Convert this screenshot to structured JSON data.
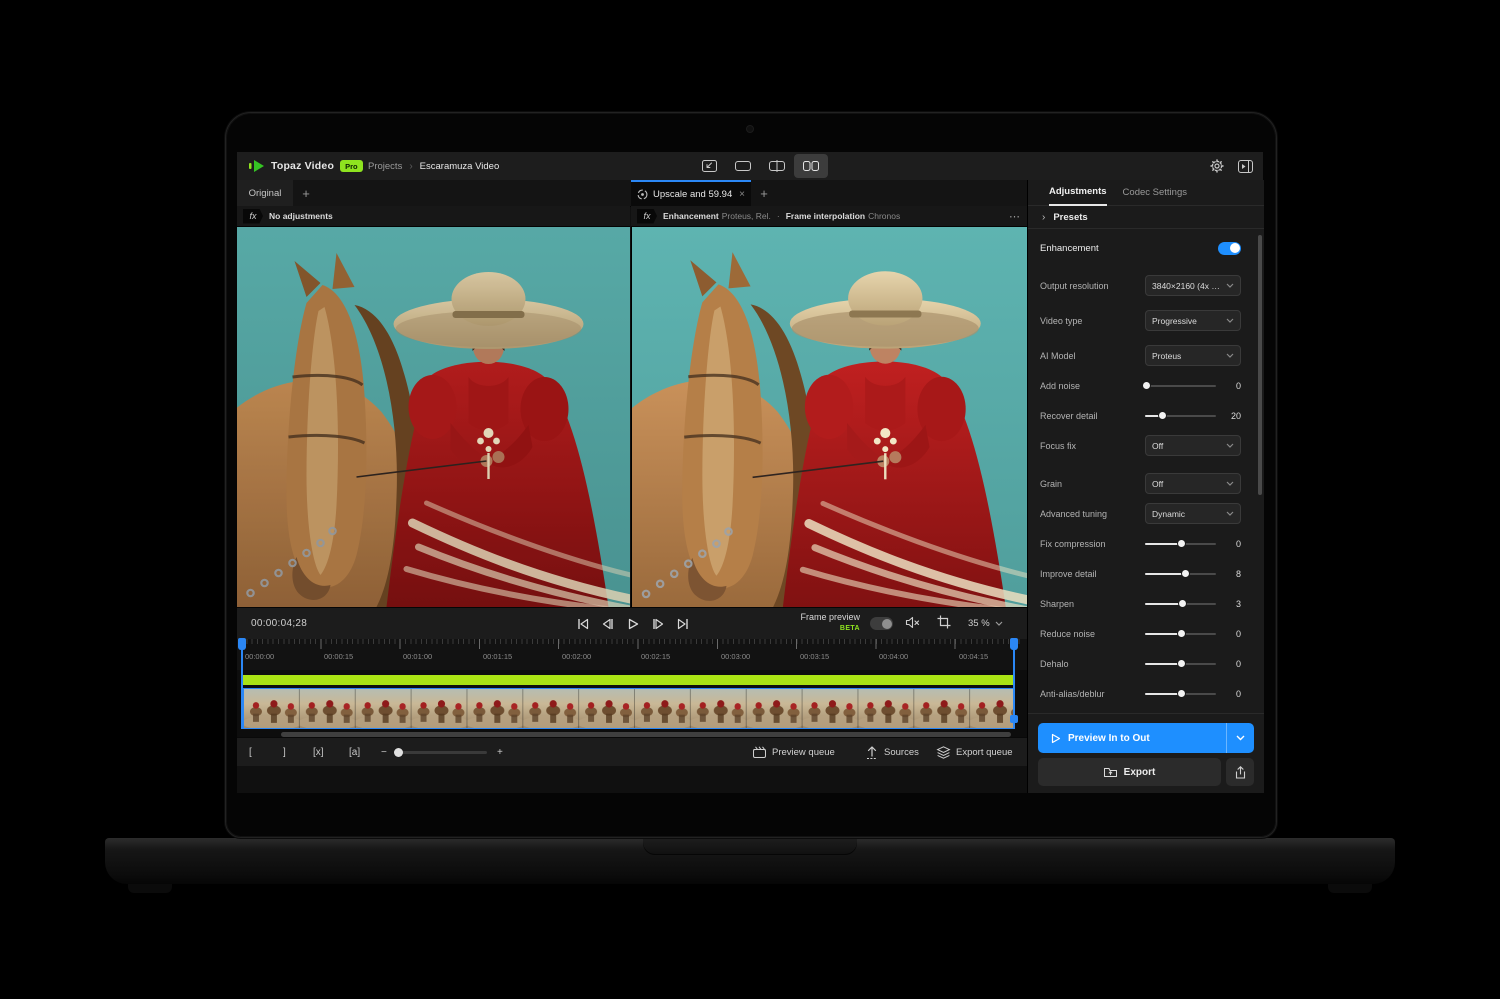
{
  "colors": {
    "accent_blue": "#1e8fff",
    "brand_green": "#8ee31f",
    "timeline_green": "#a9e214",
    "tab_accent": "#2b87f5"
  },
  "topbar": {
    "brand": "Topaz Video",
    "badge": "Pro",
    "breadcrumb": {
      "root": "Projects",
      "sep": "›",
      "current": "Escaramuza Video"
    }
  },
  "tabs": {
    "original": "Original",
    "upscale": "Upscale and 59.94",
    "close": "×",
    "plus": "+"
  },
  "preview_headers": {
    "fx": "fx",
    "left": "No adjustments",
    "right": {
      "e_label": "Enhancement",
      "e_detail": "Proteus, Rel.",
      "sep": "·",
      "f_label": "Frame interpolation",
      "f_detail": "Chronos",
      "more": "⋯"
    }
  },
  "transport": {
    "timecode": "00:00:04;28",
    "frame_preview": "Frame preview",
    "beta": "BETA",
    "zoom": "35 %"
  },
  "timeline": {
    "ticks": [
      "00:00:00",
      "00:00:15",
      "00:01:00",
      "00:01:15",
      "00:02:00",
      "00:02:15",
      "00:03:00",
      "00:03:15",
      "00:04:00",
      "00:04:15"
    ]
  },
  "bottombar": {
    "set_in": "[",
    "set_out": "]",
    "clear_inout": "[x]",
    "zoom_to_selection": "[a]",
    "minus": "−",
    "plus": "+",
    "preview_queue": "Preview queue",
    "sources": "Sources",
    "export_queue": "Export queue"
  },
  "panel": {
    "tab_adjustments": "Adjustments",
    "tab_codec": "Codec Settings",
    "presets": "Presets",
    "presets_chevron": "›",
    "enhancement": "Enhancement",
    "rows": [
      {
        "label": "Output resolution",
        "type": "dropdown",
        "value": "3840×2160 (4x …"
      },
      {
        "label": "Video type",
        "type": "dropdown",
        "value": "Progressive"
      },
      {
        "label": "AI Model",
        "type": "dropdown",
        "value": "Proteus"
      },
      {
        "label": "Add noise",
        "type": "slider",
        "value": "0",
        "pct": 2
      },
      {
        "label": "Recover detail",
        "type": "slider",
        "value": "20",
        "pct": 24
      },
      {
        "label": "Focus fix",
        "type": "dropdown",
        "value": "Off"
      },
      {
        "label": "Grain",
        "type": "dropdown",
        "value": "Off"
      },
      {
        "label": "Advanced tuning",
        "type": "dropdown",
        "value": "Dynamic"
      },
      {
        "label": "Fix compression",
        "type": "slider",
        "value": "0",
        "pct": 52
      },
      {
        "label": "Improve detail",
        "type": "slider",
        "value": "8",
        "pct": 57
      },
      {
        "label": "Sharpen",
        "type": "slider",
        "value": "3",
        "pct": 53
      },
      {
        "label": "Reduce noise",
        "type": "slider",
        "value": "0",
        "pct": 51
      },
      {
        "label": "Dehalo",
        "type": "slider",
        "value": "0",
        "pct": 51
      },
      {
        "label": "Anti-alias/deblur",
        "type": "slider",
        "value": "0",
        "pct": 52
      }
    ],
    "preview_button": "Preview In to Out",
    "export_button": "Export"
  }
}
